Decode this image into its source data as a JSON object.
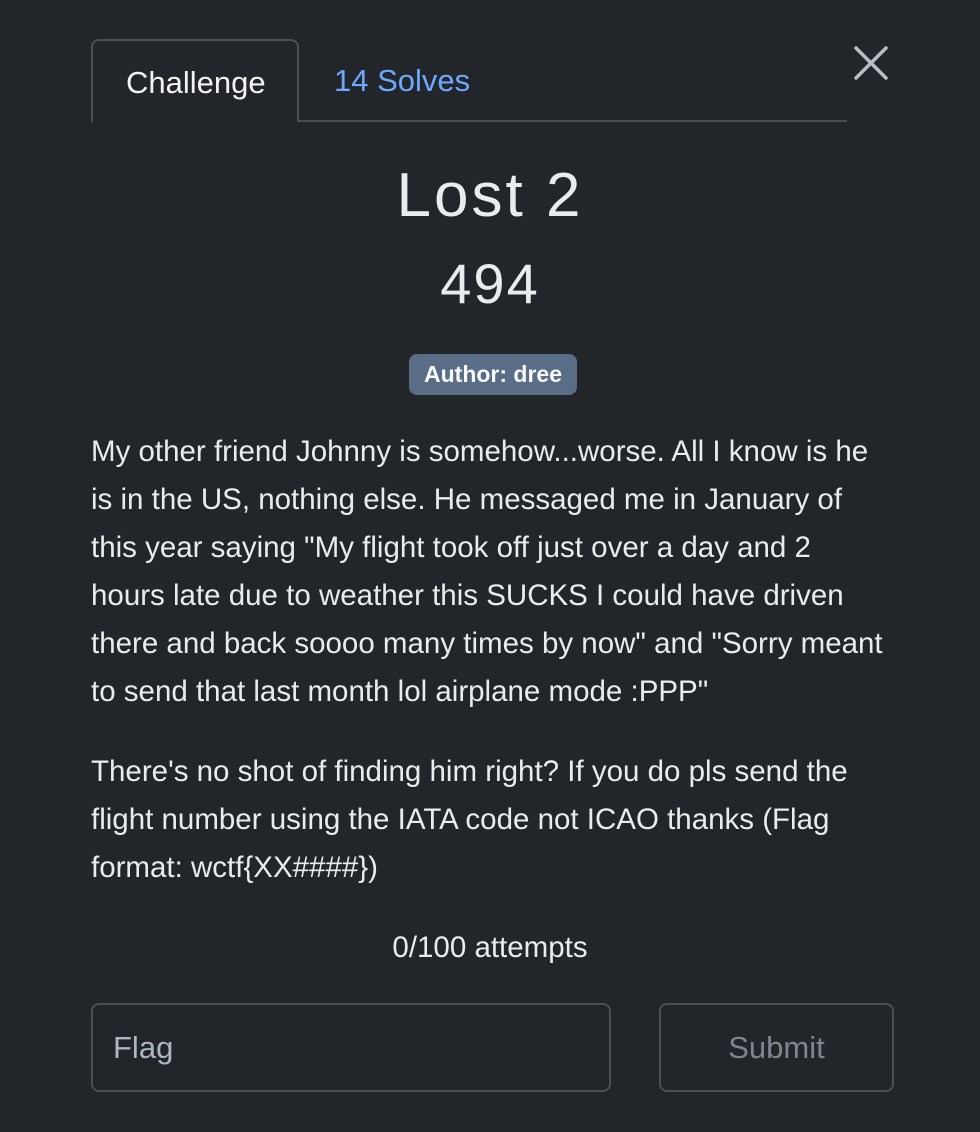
{
  "tabs": {
    "challenge_label": "Challenge",
    "solves_label": "14 Solves"
  },
  "challenge": {
    "name": "Lost 2",
    "points": "494",
    "author": "Author: dree",
    "description": [
      "My other friend Johnny is somehow...worse. All I know is he is in the US, nothing else. He messaged me in January of this year saying \"My flight took off just over a day and 2 hours late due to weather this SUCKS I could have driven there and back soooo many times by now\" and \"Sorry meant to send that last month lol airplane mode :PPP\"",
      "There's no shot of finding him right? If you do pls send the flight number using the IATA code not ICAO thanks (Flag format: wctf{XX####})"
    ],
    "attempts": "0/100 attempts"
  },
  "form": {
    "flag_placeholder": "Flag",
    "flag_value": "",
    "submit_label": "Submit"
  },
  "colors": {
    "background": "#22262a",
    "accent_link": "#6ea8fe",
    "badge": "#5a6d87",
    "border": "#4a4f55"
  },
  "icons": {
    "close": "close-icon"
  }
}
